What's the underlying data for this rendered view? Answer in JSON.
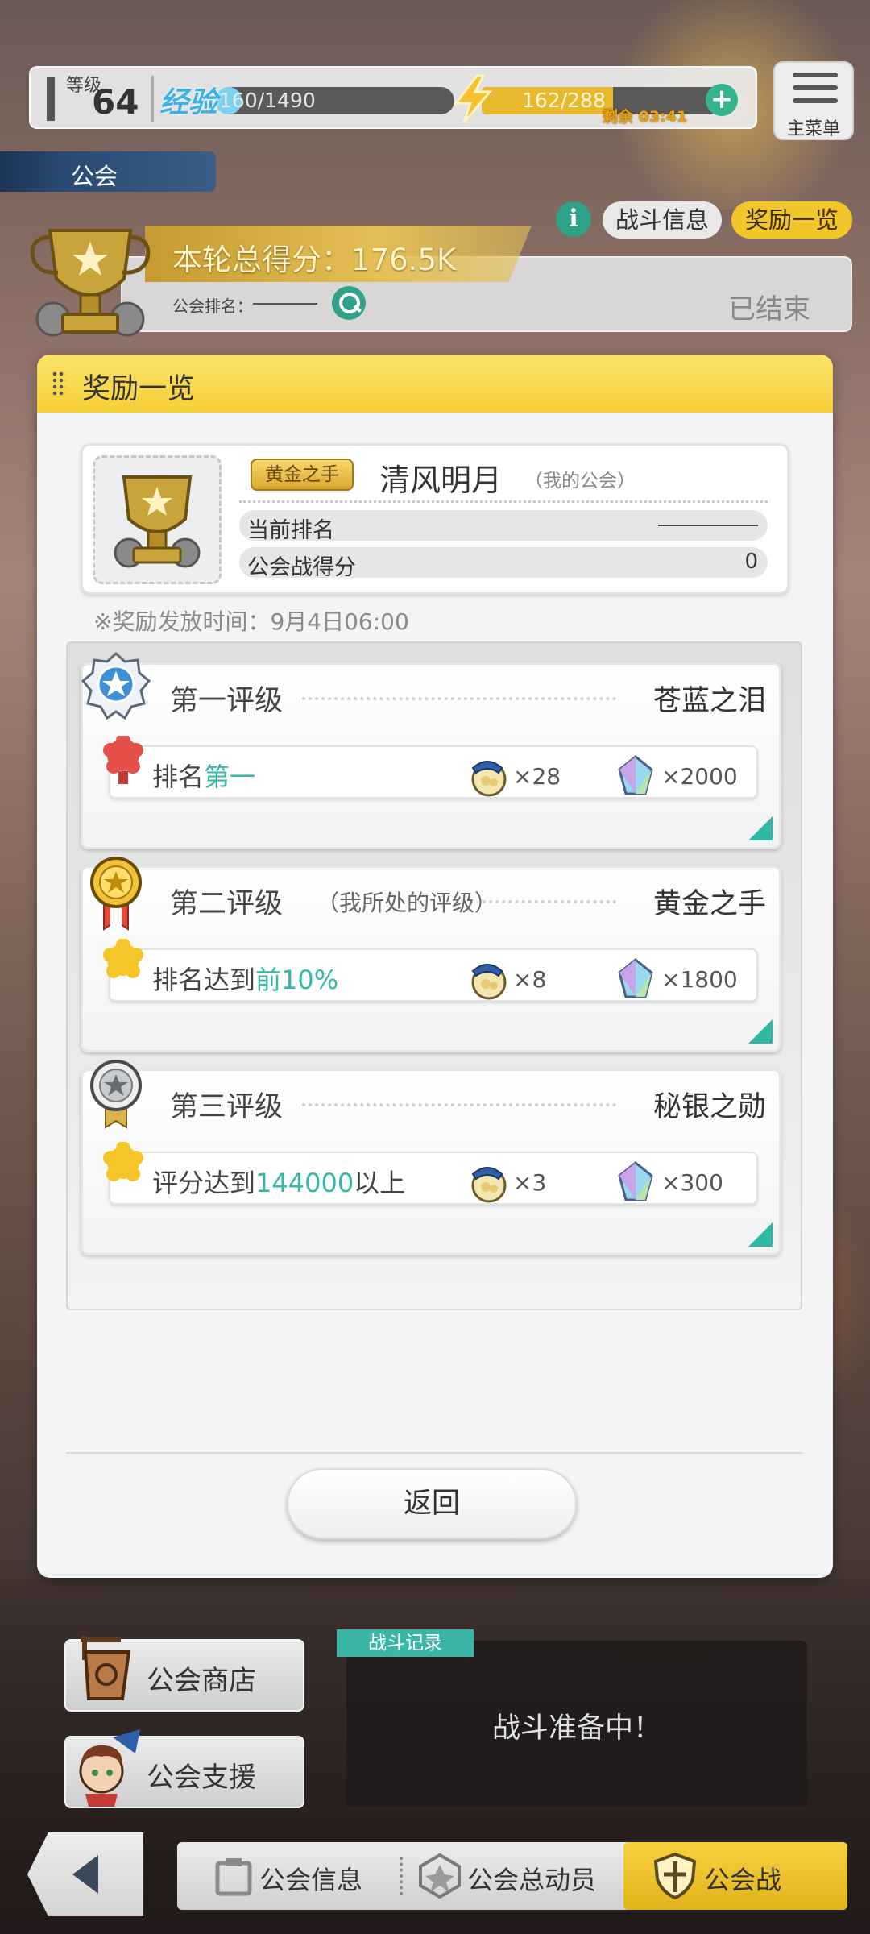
{
  "status": {
    "level_label": "等级",
    "level_value": "64",
    "exp_label": "经验",
    "exp_value": "160/1490",
    "exp_progress": 0.107,
    "stamina_value": "162/288",
    "stamina_progress": 0.5625,
    "stamina_remaining": "剩余 03:41"
  },
  "menu": {
    "label": "主菜单"
  },
  "guild_tab": {
    "label": "公会"
  },
  "header_buttons": {
    "info": "i",
    "battle_info": "战斗信息",
    "rewards": "奖励一览"
  },
  "score_panel": {
    "total_score": "本轮总得分：176.5K",
    "rank_label": "公会排名：",
    "status": "已结束"
  },
  "modal": {
    "title": "奖励一览",
    "my_guild": {
      "tier_badge": "黄金之手",
      "name": "清风明月",
      "tag": "（我的公会）",
      "rows": [
        {
          "key": "当前排名",
          "value": ""
        },
        {
          "key": "公会战得分",
          "value": "0"
        }
      ]
    },
    "reward_time": "※奖励发放时间：9月4日06:00",
    "tiers": [
      {
        "title": "第一评级",
        "mine_note": "",
        "name": "苍蓝之泪",
        "cond_prefix": "排名",
        "cond_highlight": "第一",
        "cond_suffix": "",
        "coin_qty": "×28",
        "gem_qty": "×2000"
      },
      {
        "title": "第二评级",
        "mine_note": "（我所处的评级）",
        "name": "黄金之手",
        "cond_prefix": "排名达到",
        "cond_highlight": "前10%",
        "cond_suffix": "",
        "coin_qty": "×8",
        "gem_qty": "×1800"
      },
      {
        "title": "第三评级",
        "mine_note": "",
        "name": "秘银之勋",
        "cond_prefix": "评分达到",
        "cond_highlight": "144000",
        "cond_suffix": "以上",
        "coin_qty": "×3",
        "gem_qty": "×300"
      }
    ],
    "back_button": "返回"
  },
  "side_buttons": {
    "shop": "公会商店",
    "support": "公会支援"
  },
  "battle_log": {
    "tag": "战斗记录",
    "message": "战斗准备中！"
  },
  "tabs": {
    "info": "公会信息",
    "mobilize": "公会总动员",
    "war": "公会战"
  },
  "colors": {
    "accent_teal": "#37b8a6",
    "gold": "#f2c62a",
    "exp_blue": "#3fb0e6"
  }
}
